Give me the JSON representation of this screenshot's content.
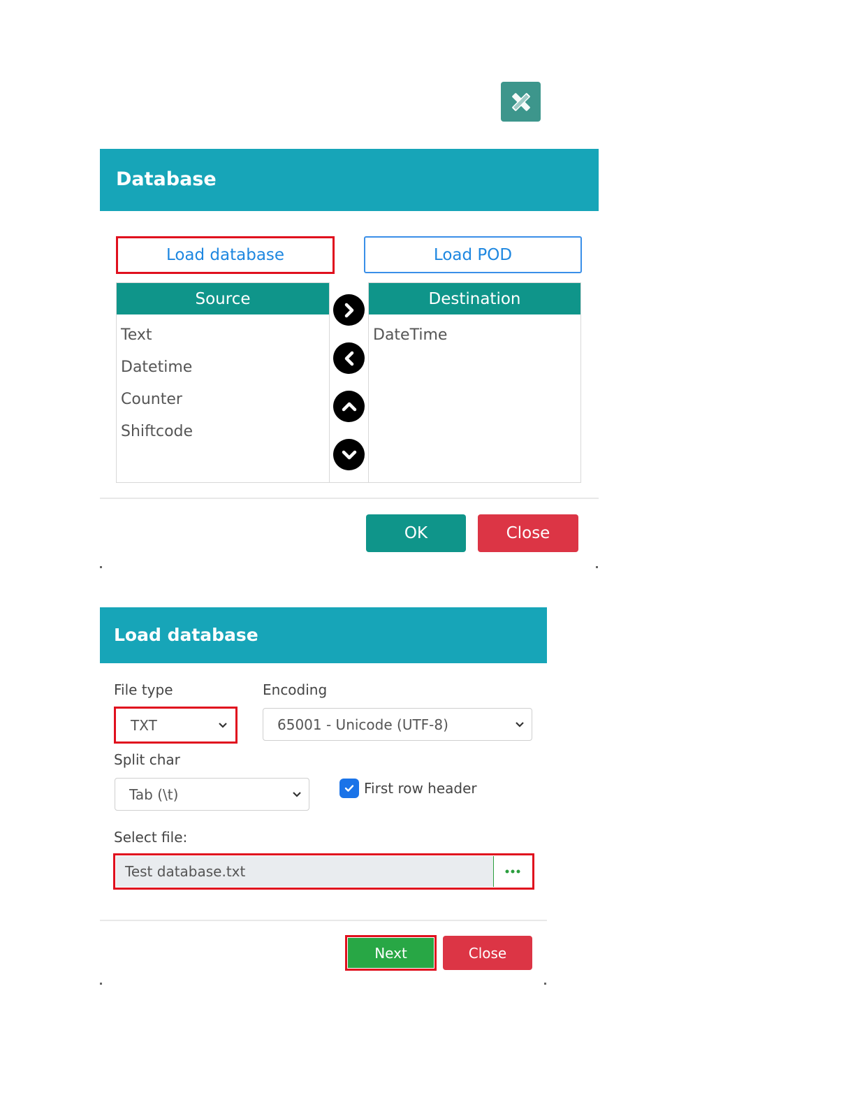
{
  "toolbar": {
    "icon": "pencil-ruler-icon",
    "accent": "#3d968c"
  },
  "database_dialog": {
    "title": "Database",
    "load_database_label": "Load database",
    "load_pod_label": "Load POD",
    "source": {
      "header": "Source",
      "items": [
        "Text",
        "Datetime",
        "Counter",
        "Shiftcode"
      ]
    },
    "destination": {
      "header": "Destination",
      "items": [
        "DateTime"
      ]
    },
    "ok_label": "OK",
    "close_label": "Close"
  },
  "load_dialog": {
    "title": "Load database",
    "file_type_label": "File type",
    "file_type_value": "TXT",
    "encoding_label": "Encoding",
    "encoding_value": "65001 - Unicode (UTF-8)",
    "split_char_label": "Split char",
    "split_char_value": "Tab (\\t)",
    "first_row_header_label": "First row header",
    "first_row_header_checked": true,
    "select_file_label": "Select file:",
    "file_value": "Test database.txt",
    "next_label": "Next",
    "close_label": "Close"
  },
  "colors": {
    "header": "#17a5b8",
    "teal": "#0f958a",
    "danger": "#dc3545",
    "success": "#28a745",
    "highlight": "#e0101e"
  }
}
